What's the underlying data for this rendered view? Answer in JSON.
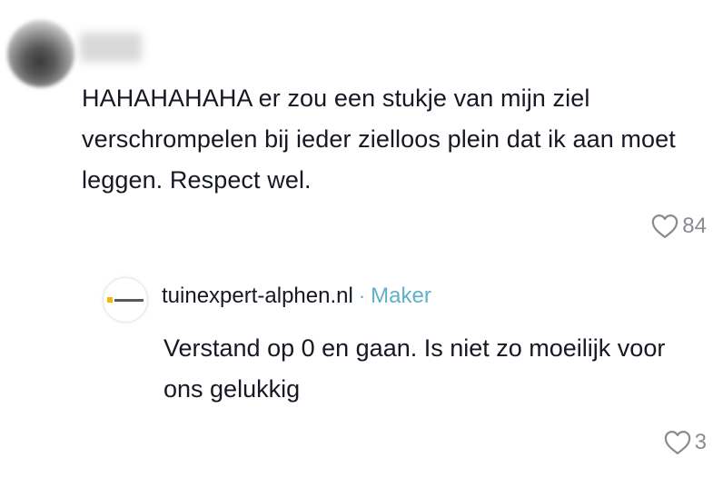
{
  "comment": {
    "text": "HAHAHAHAHA er zou een stukje van mijn ziel verschrompelen bij ieder zielloos plein dat ik aan moet leggen. Respect wel.",
    "like_count": "84",
    "like_icon": "heart-outline-icon"
  },
  "reply": {
    "username": "tuinexpert-alphen.nl",
    "separator": "·",
    "badge": "Maker",
    "text": "Verstand op 0 en gaan. Is niet zo moeilijk voor ons gelukkig",
    "like_count": "3",
    "like_icon": "heart-outline-icon",
    "badge_color": "#5fb0c8"
  },
  "colors": {
    "text": "#161823",
    "muted": "#8a8b91",
    "accent": "#5fb0c8"
  }
}
